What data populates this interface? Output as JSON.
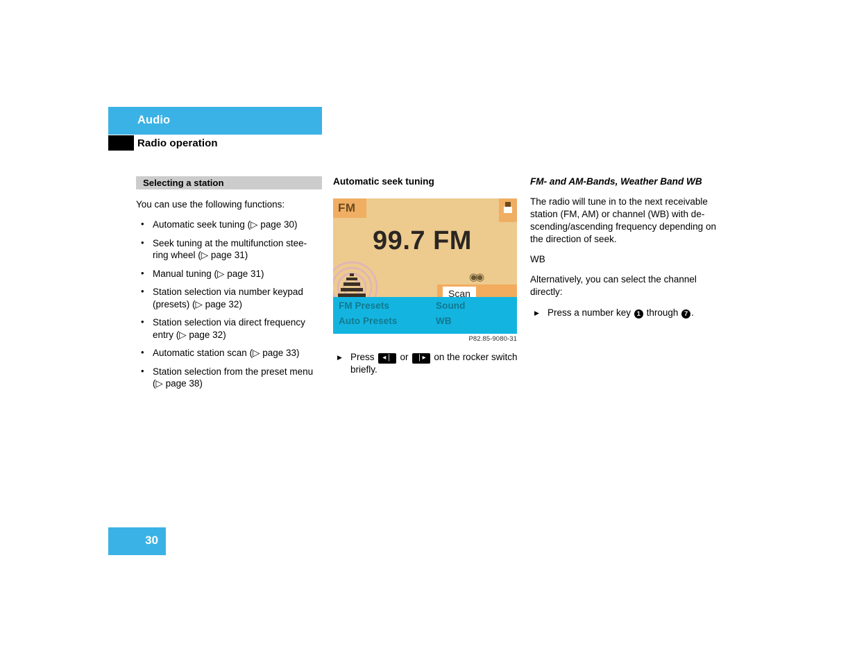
{
  "header": {
    "title": "Audio",
    "subtitle": "Radio operation"
  },
  "left_column": {
    "section_title": "Selecting a station",
    "intro": "You can use the following functions:",
    "items": [
      "Automatic seek tuning (▷ page 30)",
      "Seek tuning at the multifunction stee-ring wheel (▷ page 31)",
      "Manual tuning (▷ page 31)",
      "Station selection via number keypad (presets) (▷ page 32)",
      "Station selection via direct frequency entry (▷ page 32)",
      "Automatic station scan (▷ page 33)",
      "Station selection from the preset menu (▷ page 38)"
    ]
  },
  "middle_column": {
    "heading": "Automatic seek tuning",
    "display": {
      "band_badge": "FM",
      "frequency": "99.7 FM",
      "stereo_icon": "stereo-icon",
      "scan_button": "Scan",
      "menu_items": [
        "FM Presets",
        "Auto Presets",
        "Sound",
        "WB"
      ],
      "tower_icon": "broadcast-tower-icon",
      "corner_icon": "traffic-info-icon"
    },
    "figure_caption": "P82.85-9080-31",
    "step": {
      "prefix": "Press",
      "key_prev": "◂❘",
      "key_sep": "or",
      "key_next": "❘▸",
      "suffix": "on the rocker switch briefly."
    }
  },
  "right_column": {
    "heading": "FM- and AM-Bands, Weather Band WB",
    "paragraph1": "The radio will tune in to the next receivable station (FM, AM) or channel (WB) with de-scending/ascending frequency depending on the direction of seek.",
    "label_wb": "WB",
    "paragraph2": "Alternatively, you can select the channel directly:",
    "step": {
      "prefix": "Press a number key",
      "key_from": "1",
      "middle": "through",
      "key_to": "7",
      "suffix": "."
    }
  },
  "footer": {
    "page_number": "30"
  },
  "colors": {
    "header_blue": "#3bb2e5",
    "display_blue": "#13b5e0",
    "section_gray": "#cccccc",
    "display_bg": "#edca8e",
    "display_orange": "#f0ae63"
  }
}
